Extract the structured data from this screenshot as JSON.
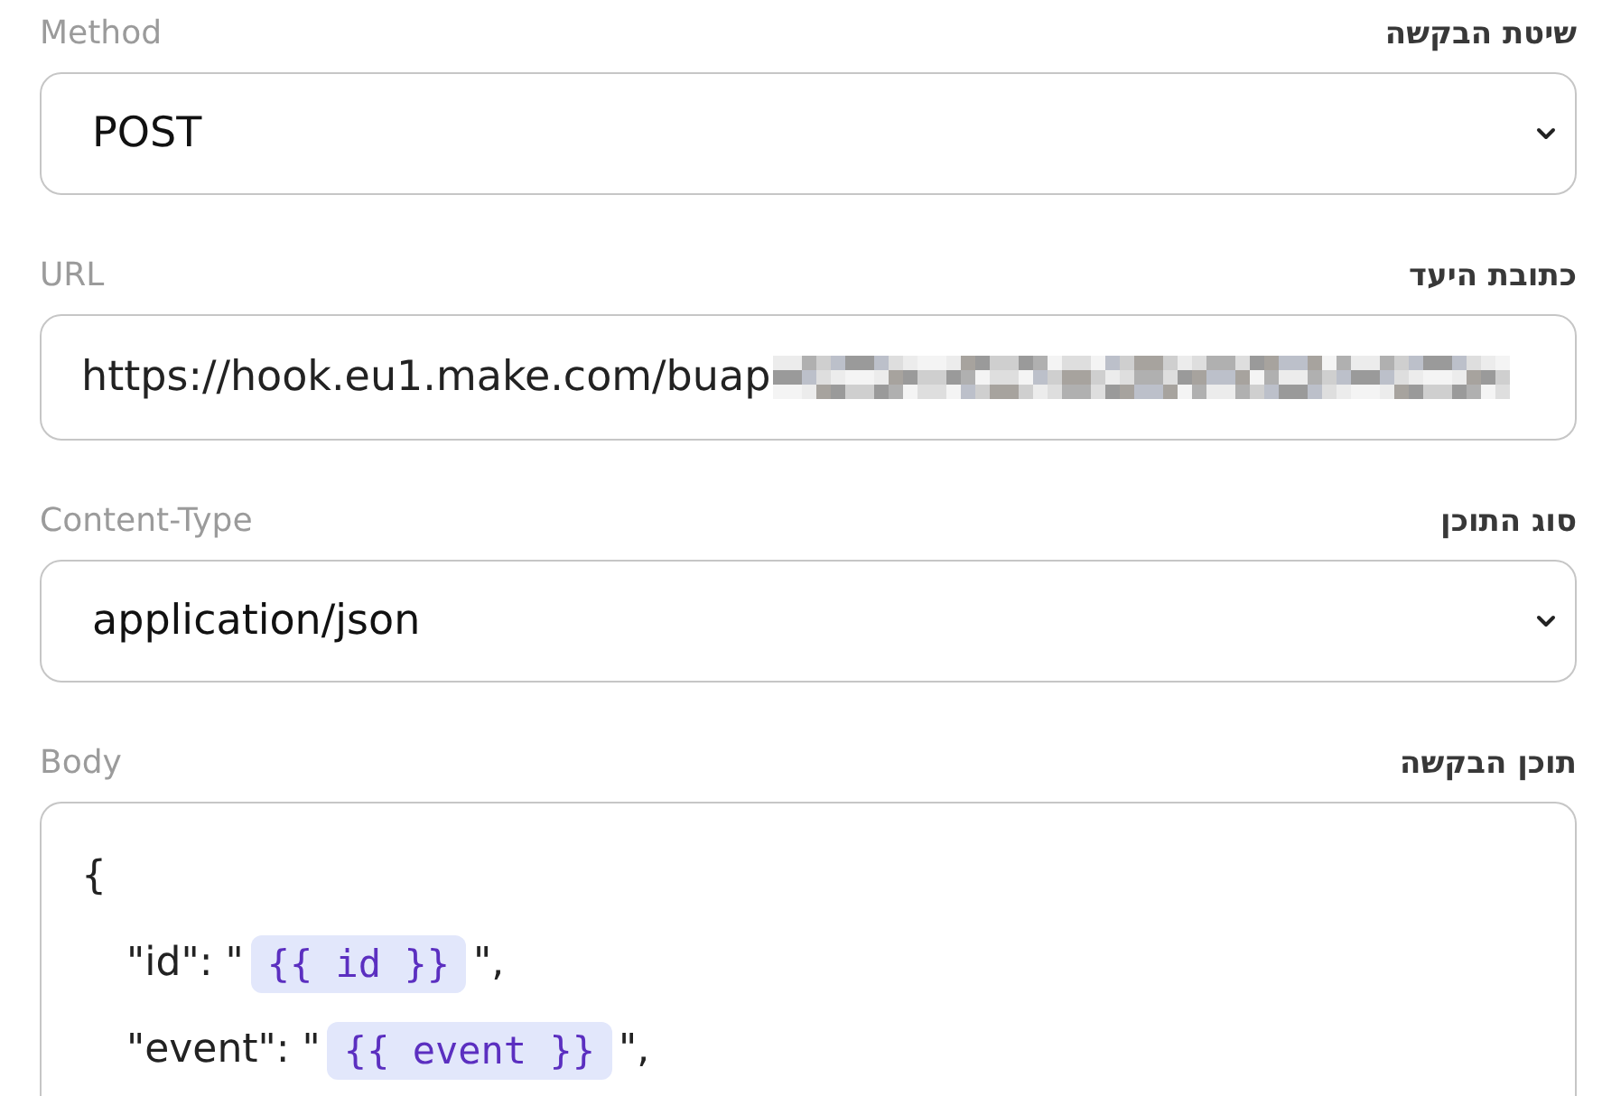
{
  "form": {
    "fields": [
      {
        "kind": "select",
        "label": "שיטת הבקשה",
        "label_en": "Method",
        "value": "POST"
      },
      {
        "kind": "text",
        "label": "כתובת היעד",
        "label_en": "URL",
        "value": "https://hook.eu1.make.com/buap",
        "redacted": true
      },
      {
        "kind": "select",
        "label": "סוג התוכן",
        "label_en": "Content-Type",
        "value": "application/json"
      },
      {
        "kind": "code",
        "label": "תוכן הבקשה",
        "label_en": "Body",
        "lines": [
          {
            "segments": [
              {
                "kind": "text",
                "text": "{"
              }
            ],
            "children": [
              {
                "segments": [
                  {
                    "kind": "text",
                    "text": "\"id\": \""
                  },
                  {
                    "kind": "variable",
                    "text": "{{ id }}"
                  },
                  {
                    "kind": "text",
                    "text": "\","
                  }
                ]
              },
              {
                "segments": [
                  {
                    "kind": "text",
                    "text": "\"event\": \""
                  },
                  {
                    "kind": "variable",
                    "text": "{{ event }}"
                  },
                  {
                    "kind": "text",
                    "text": "\","
                  }
                ]
              }
            ]
          }
        ]
      }
    ]
  }
}
